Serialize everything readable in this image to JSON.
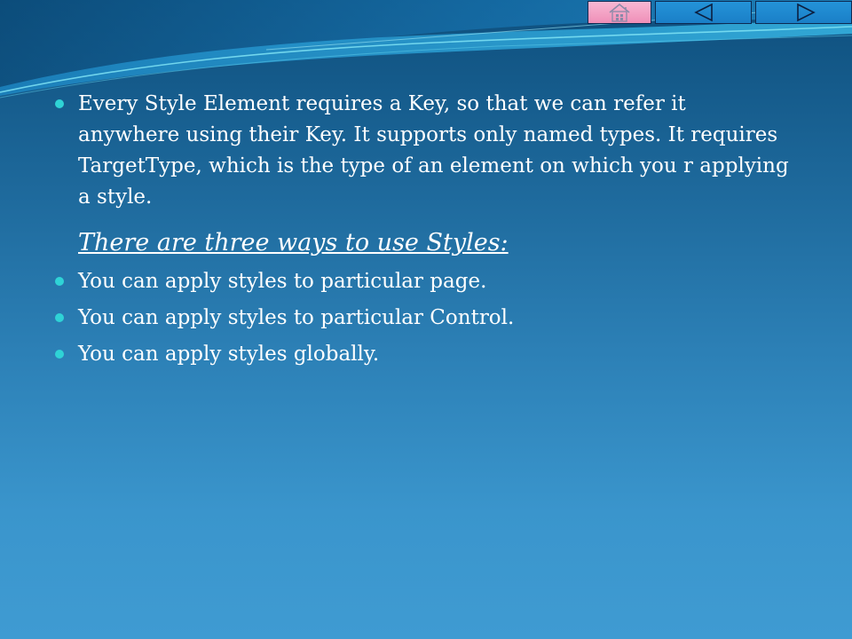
{
  "nav": {
    "home_icon": "home-icon",
    "prev_icon": "triangle-left-icon",
    "next_icon": "triangle-right-icon"
  },
  "slide": {
    "paragraph": "Every Style Element requires a Key, so that we can refer it anywhere using their Key. It supports only named types. It requires TargetType, which is the type of an element on which you r applying a style.",
    "subheading": "There are three ways to use Styles:",
    "items": [
      "You can apply styles to particular page.",
      "You can apply styles to particular Control.",
      "You can apply styles globally."
    ]
  },
  "colors": {
    "background_top": "#0e4f7d",
    "background_bottom": "#3f9bd2",
    "bullet": "#2fd3d6",
    "text": "#ffffff",
    "home_button": "#ef8fb8",
    "nav_button": "#1a7fc7"
  }
}
